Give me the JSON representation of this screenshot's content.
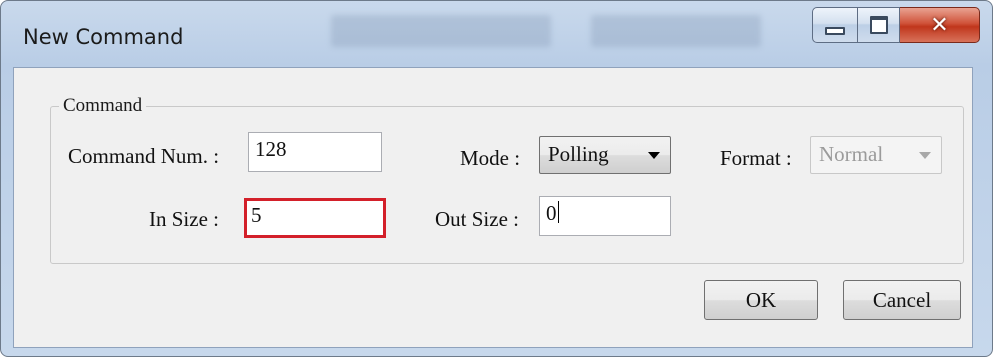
{
  "window": {
    "title": "New Command"
  },
  "caption": {
    "minimize_icon": "minimize-icon",
    "maximize_icon": "maximize-icon",
    "close_glyph": "✕"
  },
  "group": {
    "label": "Command"
  },
  "fields": {
    "command_num_label": "Command Num. :",
    "command_num_value": "128",
    "mode_label": "Mode :",
    "mode_value": "Polling",
    "format_label": "Format :",
    "format_value": "Normal",
    "in_size_label": "In Size :",
    "in_size_value": "5",
    "out_size_label": "Out Size :",
    "out_size_value": "0"
  },
  "buttons": {
    "ok": "OK",
    "cancel": "Cancel"
  },
  "colors": {
    "highlight": "#d3202a",
    "close_button": "#c0361c"
  }
}
